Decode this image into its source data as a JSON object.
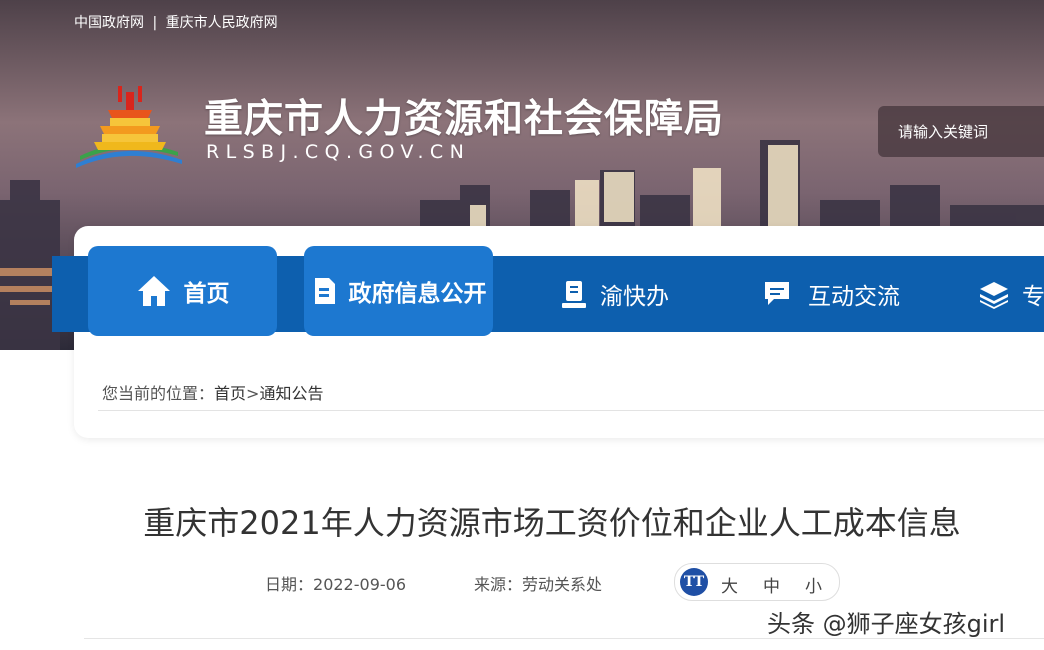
{
  "colors": {
    "nav_bar": "#0d5fae",
    "nav_tab": "#1d78d0",
    "title_text": "#333333",
    "fontsize_badge": "#1f4fa5"
  },
  "top_links": {
    "gov": "中国政府网",
    "separator": "|",
    "city": "重庆市人民政府网"
  },
  "header": {
    "logo_icon": "tiantan-temple-logo",
    "title": "重庆市人力资源和社会保障局",
    "domain": "RLSBJ.CQ.GOV.CN",
    "search_placeholder": "请输入关键词"
  },
  "nav": {
    "items": [
      {
        "label": "首页",
        "icon": "home-icon"
      },
      {
        "label": "政府信息公开",
        "icon": "document-icon"
      },
      {
        "label": "渝快办",
        "icon": "service-icon"
      },
      {
        "label": "互动交流",
        "icon": "chat-icon"
      },
      {
        "label": "专",
        "icon": "layers-icon"
      }
    ]
  },
  "breadcrumb": {
    "prefix": "您当前的位置：",
    "home": "首页",
    "separator": ">",
    "current": "通知公告"
  },
  "article": {
    "title": "重庆市2021年人力资源市场工资价位和企业人工成本信息",
    "date_label": "日期：",
    "date": "2022-09-06",
    "source_label": "来源：",
    "source": "劳动关系处",
    "fontsize_icon": "TT",
    "fontsize_options": [
      "大",
      "中",
      "小"
    ]
  },
  "watermark": "头条 @狮子座女孩girl"
}
